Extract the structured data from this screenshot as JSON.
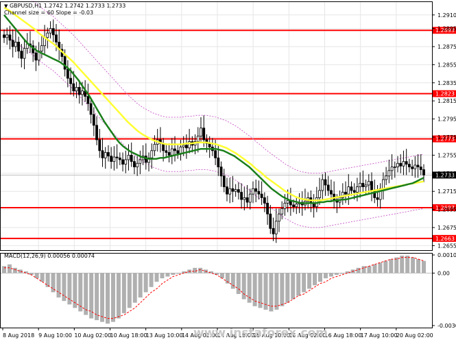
{
  "header": {
    "symbol_line": "GBPUSD,H1  1.2742 1.2742 1.2733 1.2733",
    "channel_line": "Channel size = 60 Slope = -0.03"
  },
  "macd": {
    "label": "MACD(12,26,9) 0.00056 0.00074",
    "ticks": [
      "0.00104",
      "0.00",
      "-0.00301"
    ]
  },
  "watermark": "www.instaforex.com",
  "colors": {
    "background": "#ffffff",
    "level_line": "#ff0000",
    "ma_fast": "#1a7f1a",
    "ma_slow": "#ffff33",
    "channel": "#cc66cc",
    "candle": "#000000",
    "macd_hist": "#b0b0b0",
    "macd_signal": "#ff0000",
    "watermark": "#c8c8c8"
  },
  "chart_data": {
    "type": "candlestick",
    "symbol": "GBPUSD",
    "timeframe": "H1",
    "ylim": [
      1.265,
      1.2925
    ],
    "y_ticks": [
      "1.2910",
      "1.2895",
      "1.2875",
      "1.2855",
      "1.2835",
      "1.2815",
      "1.2795",
      "1.2775",
      "1.2755",
      "1.2735",
      "1.2715",
      "1.2695",
      "1.2675",
      "1.2655"
    ],
    "y_tick_values": [
      1.291,
      1.2895,
      1.2875,
      1.2855,
      1.2835,
      1.2815,
      1.2795,
      1.2775,
      1.2755,
      1.2735,
      1.2715,
      1.2695,
      1.2675,
      1.2655
    ],
    "x_labels": [
      "8 Aug 2018",
      "9 Aug 10:00",
      "10 Aug 02:00",
      "10 Aug 18:00",
      "13 Aug 10:00",
      "14 Aug 02:00",
      "14 Aug 18:00",
      "15 Aug 10:00",
      "16 Aug 02:00",
      "16 Aug 18:00",
      "17 Aug 10:00",
      "20 Aug 02:00"
    ],
    "levels": [
      {
        "label": "1.2893",
        "value": 1.2893
      },
      {
        "label": "1.2823",
        "value": 1.2823
      },
      {
        "label": "1.2773",
        "value": 1.2773
      },
      {
        "label": "1.2697",
        "value": 1.2697
      },
      {
        "label": "1.2663",
        "value": 1.2663
      }
    ],
    "current_price": {
      "label": "1.2733",
      "value": 1.2733
    },
    "close_series": [
      1.2885,
      1.2888,
      1.2882,
      1.2875,
      1.288,
      1.287,
      1.2862,
      1.2873,
      1.2878,
      1.2876,
      1.2868,
      1.286,
      1.287,
      1.2876,
      1.2885,
      1.289,
      1.2895,
      1.2888,
      1.288,
      1.2872,
      1.2864,
      1.285,
      1.284,
      1.2834,
      1.2826,
      1.283,
      1.2822,
      1.2826,
      1.282,
      1.2812,
      1.28,
      1.2788,
      1.2772,
      1.276,
      1.2752,
      1.2758,
      1.2754,
      1.2748,
      1.2753,
      1.2752,
      1.275,
      1.2745,
      1.275,
      1.2755,
      1.2748,
      1.2742,
      1.2746,
      1.275,
      1.2754,
      1.2747,
      1.2752,
      1.276,
      1.2767,
      1.2772,
      1.2768,
      1.276,
      1.2758,
      1.2755,
      1.2762,
      1.276,
      1.2757,
      1.2764,
      1.2766,
      1.2763,
      1.277,
      1.2766,
      1.277,
      1.2776,
      1.2785,
      1.2772,
      1.2768,
      1.2764,
      1.276,
      1.2752,
      1.2742,
      1.2732,
      1.272,
      1.2712,
      1.2718,
      1.2715,
      1.2717,
      1.2714,
      1.2706,
      1.2708,
      1.2703,
      1.2712,
      1.2718,
      1.2715,
      1.2712,
      1.2708,
      1.2702,
      1.269,
      1.2674,
      1.2668,
      1.2682,
      1.269,
      1.2696,
      1.2702,
      1.2705,
      1.27,
      1.2698,
      1.2701,
      1.2703,
      1.27,
      1.2704,
      1.2708,
      1.2702,
      1.2698,
      1.2708,
      1.2716,
      1.2728,
      1.2722,
      1.2716,
      1.2712,
      1.2706,
      1.2703,
      1.2708,
      1.2714,
      1.2712,
      1.272,
      1.2716,
      1.2714,
      1.272,
      1.2724,
      1.272,
      1.2722,
      1.2726,
      1.2716,
      1.2708,
      1.2706,
      1.2718,
      1.2728,
      1.2732,
      1.2738,
      1.2742,
      1.2742,
      1.2746,
      1.2743,
      1.2748,
      1.2745,
      1.2742,
      1.274,
      1.2744,
      1.2742,
      1.2739,
      1.2733
    ],
    "ma_fast_series": [
      1.291,
      1.2905,
      1.29,
      1.2895,
      1.289,
      1.2885,
      1.288,
      1.2876,
      1.2873,
      1.287,
      1.2868,
      1.2866,
      1.2864,
      1.2862,
      1.286,
      1.2858,
      1.2855,
      1.2852,
      1.2848,
      1.2843,
      1.2838,
      1.2832,
      1.2826,
      1.282,
      1.2813,
      1.2806,
      1.2799,
      1.2792,
      1.2786,
      1.278,
      1.2774,
      1.2769,
      1.2765,
      1.2762,
      1.2759,
      1.2757,
      1.2755,
      1.2753,
      1.2752,
      1.2751,
      1.2751,
      1.2751,
      1.2752,
      1.2752,
      1.2753,
      1.2754,
      1.2755,
      1.2756,
      1.2757,
      1.2758,
      1.2759,
      1.276,
      1.2761,
      1.2762,
      1.2762,
      1.2762,
      1.2762,
      1.2762,
      1.2761,
      1.276,
      1.2758,
      1.2756,
      1.2754,
      1.2751,
      1.2748,
      1.2745,
      1.2742,
      1.2738,
      1.2734,
      1.273,
      1.2726,
      1.2722,
      1.2718,
      1.2715,
      1.2712,
      1.2709,
      1.2707,
      1.2705,
      1.2704,
      1.2703,
      1.2702,
      1.2702,
      1.2702,
      1.2702,
      1.2702,
      1.2703,
      1.2703,
      1.2704,
      1.2704,
      1.2705,
      1.2705,
      1.2706,
      1.2706,
      1.2707,
      1.2708,
      1.2709,
      1.271,
      1.2711,
      1.2712,
      1.2713,
      1.2714,
      1.2715,
      1.2716,
      1.2717,
      1.2718,
      1.2719,
      1.272,
      1.2721,
      1.2722,
      1.2723,
      1.2724,
      1.2726,
      1.2728,
      1.273
    ],
    "ma_slow_series": [
      1.2918,
      1.2915,
      1.2911,
      1.2907,
      1.2903,
      1.2899,
      1.2895,
      1.289,
      1.2886,
      1.2882,
      1.2878,
      1.2873,
      1.2868,
      1.2863,
      1.2858,
      1.2852,
      1.2846,
      1.284,
      1.2834,
      1.2828,
      1.2822,
      1.2816,
      1.281,
      1.2804,
      1.2798,
      1.2792,
      1.2787,
      1.2782,
      1.2778,
      1.2775,
      1.2772,
      1.277,
      1.2768,
      1.2767,
      1.2767,
      1.2767,
      1.2767,
      1.2768,
      1.2768,
      1.2769,
      1.2769,
      1.2769,
      1.2768,
      1.2767,
      1.2765,
      1.2763,
      1.276,
      1.2757,
      1.2753,
      1.2749,
      1.2745,
      1.274,
      1.2736,
      1.2731,
      1.2727,
      1.2723,
      1.2719,
      1.2715,
      1.2712,
      1.2709,
      1.2707,
      1.2706,
      1.2705,
      1.2705,
      1.2705,
      1.2706,
      1.2707,
      1.2708,
      1.2709,
      1.271,
      1.2711,
      1.2712,
      1.2713,
      1.2714,
      1.2715,
      1.2716,
      1.2717,
      1.2718,
      1.2719,
      1.272,
      1.2721,
      1.2722,
      1.2723,
      1.2724,
      1.2725,
      1.2726
    ],
    "macd_hist": [
      0.0004,
      0.0005,
      0.0003,
      0.0002,
      0.0001,
      -0.0001,
      -0.0003,
      -0.0005,
      -0.0008,
      -0.0011,
      -0.0014,
      -0.0016,
      -0.0018,
      -0.002,
      -0.0022,
      -0.0024,
      -0.0026,
      -0.0027,
      -0.0028,
      -0.0029,
      -0.0028,
      -0.0026,
      -0.0023,
      -0.002,
      -0.0017,
      -0.0014,
      -0.0011,
      -0.0008,
      -0.0005,
      -0.0003,
      -0.0002,
      -0.0001,
      0.0,
      0.0001,
      0.0002,
      0.0003,
      0.0003,
      0.0002,
      0.0001,
      -0.0001,
      -0.0003,
      -0.0006,
      -0.0009,
      -0.0012,
      -0.0015,
      -0.0017,
      -0.0019,
      -0.002,
      -0.0021,
      -0.0022,
      -0.0021,
      -0.0019,
      -0.0017,
      -0.0015,
      -0.0013,
      -0.0011,
      -0.0009,
      -0.0007,
      -0.0005,
      -0.0003,
      -0.0002,
      -0.0001,
      0.0,
      0.0001,
      0.0002,
      0.0003,
      0.0004,
      0.0004,
      0.0005,
      0.0006,
      0.0007,
      0.0008,
      0.0009,
      0.001,
      0.001,
      0.0009,
      0.0008,
      0.0007
    ],
    "macd_signal": [
      0.0003,
      0.0003,
      0.0002,
      0.0001,
      0.0,
      -0.0001,
      -0.0003,
      -0.0005,
      -0.0007,
      -0.0009,
      -0.0011,
      -0.0013,
      -0.0015,
      -0.0017,
      -0.0019,
      -0.0021,
      -0.0022,
      -0.0024,
      -0.0025,
      -0.0026,
      -0.0026,
      -0.0025,
      -0.0024,
      -0.0022,
      -0.002,
      -0.0017,
      -0.0014,
      -0.0011,
      -0.0009,
      -0.0006,
      -0.0004,
      -0.0002,
      -0.0001,
      0.0,
      0.0001,
      0.0001,
      0.0002,
      0.0001,
      0.0,
      -0.0001,
      -0.0003,
      -0.0005,
      -0.0007,
      -0.0009,
      -0.0012,
      -0.0014,
      -0.0016,
      -0.0017,
      -0.0018,
      -0.0019,
      -0.0019,
      -0.0018,
      -0.0017,
      -0.0015,
      -0.0013,
      -0.0012,
      -0.001,
      -0.0008,
      -0.0006,
      -0.0005,
      -0.0003,
      -0.0002,
      -0.0001,
      0.0,
      0.0001,
      0.0002,
      0.0003,
      0.0004,
      0.0005,
      0.0006,
      0.0007,
      0.0008,
      0.0008,
      0.0009,
      0.0009,
      0.0009,
      0.0008,
      0.0007
    ],
    "macd_ylim": [
      -0.00301,
      0.00104
    ]
  }
}
